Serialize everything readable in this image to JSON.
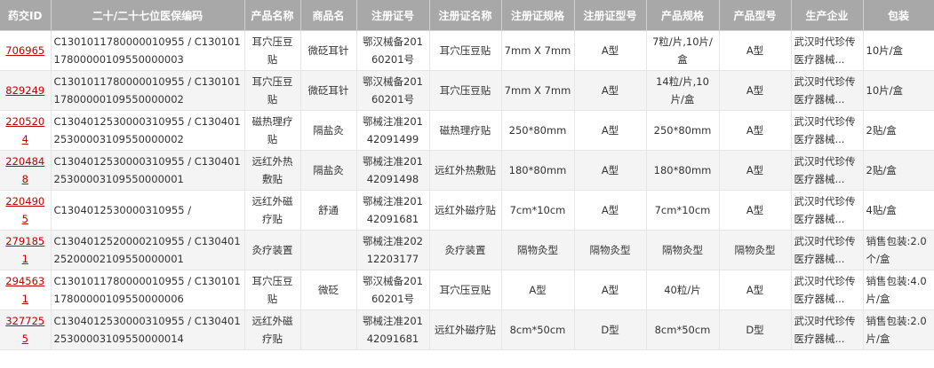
{
  "headers": [
    "药交ID",
    "二十/二十七位医保编码",
    "产品名称",
    "商品名",
    "注册证号",
    "注册证名称",
    "注册证规格",
    "注册证型号",
    "产品规格",
    "产品型号",
    "生产企业",
    "包装"
  ],
  "rows": [
    [
      "706965",
      "C130101178000001095​5 / C1301011780000010955000000​3",
      "耳穴压豆贴",
      "微砭耳针",
      "鄂汉械备20160201号",
      "耳穴压豆贴",
      "7mm X 7mm",
      "A型",
      "7粒/片,10片/盒",
      "A型",
      "武汉时代珍传医疗器械...",
      "10片/盒"
    ],
    [
      "829249",
      "C1301011780000010955 / C1301011780000010955000000​2",
      "耳穴压豆贴",
      "微砭耳针",
      "鄂汉械备20160201号",
      "耳穴压豆贴",
      "7mm X 7mm",
      "A型",
      "14粒/片,10片/盒",
      "A型",
      "武汉时代珍传医疗器械...",
      "10片/盒"
    ],
    [
      "2205204",
      "C1304012530000310955 / C1304012530000310955000000​2",
      "磁热理疗贴",
      "隔盐灸",
      "鄂械注准20142091499",
      "磁热理疗贴",
      "250*80mm",
      "A型",
      "250*80mm",
      "A型",
      "武汉时代珍传医疗器械...",
      "2贴/盒"
    ],
    [
      "2204848",
      "C1304012530000310955 / C1304012530000310955000000​1",
      "远红外热敷贴",
      "隔盐灸",
      "鄂械注准20142091498",
      "远红外热敷贴",
      "180*80mm",
      "A型",
      "180*80mm",
      "A型",
      "武汉时代珍传医疗器械...",
      "2贴/盒"
    ],
    [
      "2204905",
      "C1304012530000310955 /",
      "远红外磁疗贴",
      "舒通",
      "鄂械注准20142091681",
      "远红外磁疗贴",
      "7cm*10cm",
      "A型",
      "7cm*10cm",
      "A型",
      "武汉时代珍传医疗器械...",
      "4贴/盒"
    ],
    [
      "2791851",
      "C1304012520000210955 / C1304012520000210955000000​1",
      "灸疗装置",
      "",
      "鄂械注准20212203177",
      "灸疗装置",
      "隔物灸型",
      "隔物灸型",
      "隔物灸型",
      "隔物灸型",
      "武汉时代珍传医疗器械...",
      "销售包装:2.0个/盒"
    ],
    [
      "2945631",
      "C1301011780000010955 / C1301011780000010955000000​6",
      "耳穴压豆贴",
      "微砭",
      "鄂汉械备20160201号",
      "耳穴压豆贴",
      "A型",
      "A型",
      "40粒/片",
      "A型",
      "武汉时代珍传医疗器械...",
      "销售包装:4.0片/盒"
    ],
    [
      "3277255",
      "C1304012530000310955 / C1304012530000310955000001​4",
      "远红外磁疗贴",
      "",
      "鄂械注准20142091681",
      "远红外磁疗贴",
      "8cm*50cm",
      "D型",
      "8cm*50cm",
      "D型",
      "武汉时代珍传医疗器械...",
      "销售包装:2.0片/盒"
    ]
  ]
}
